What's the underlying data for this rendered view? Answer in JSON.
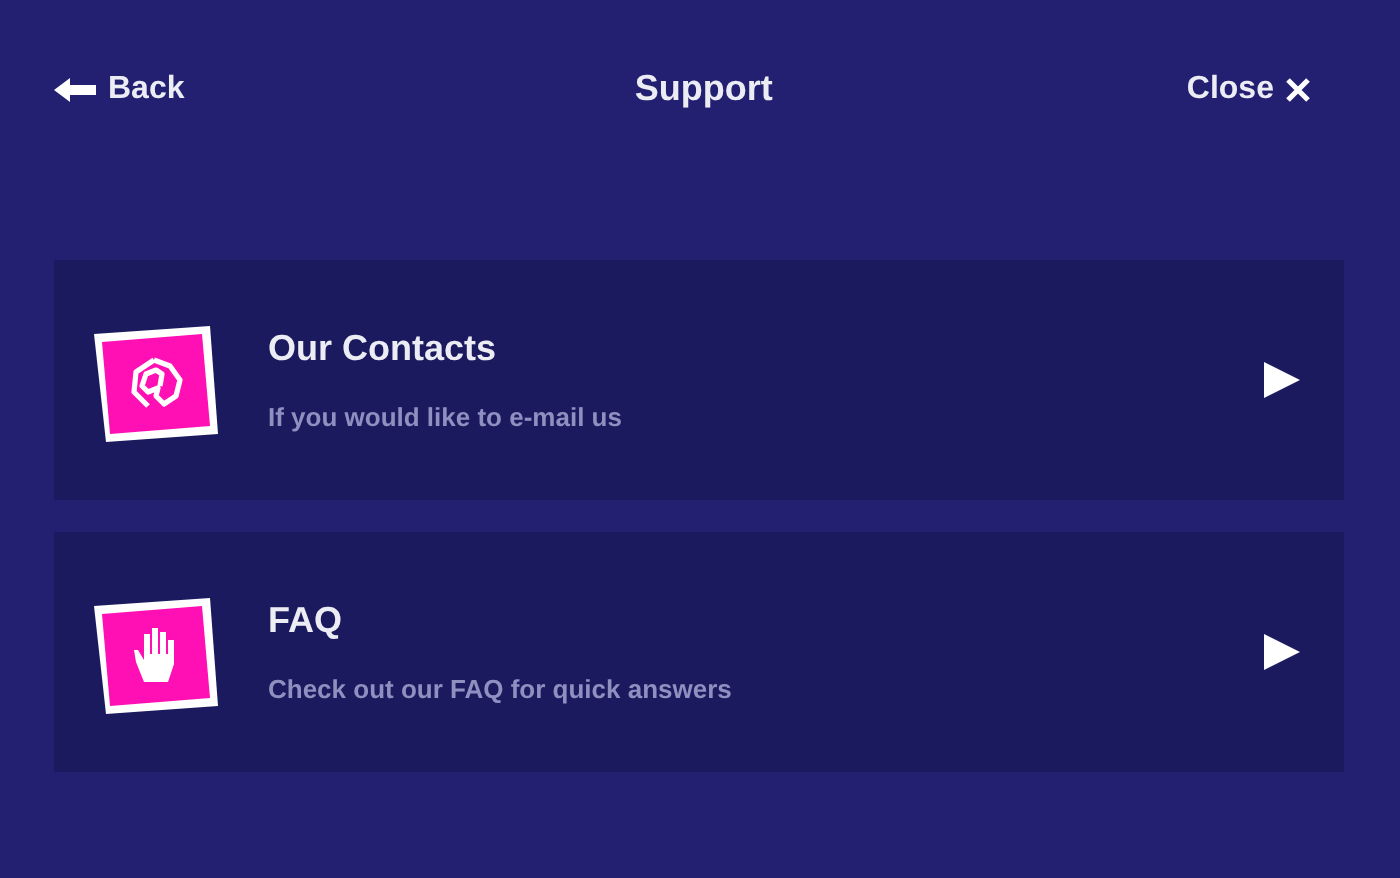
{
  "header": {
    "back": "Back",
    "title": "Support",
    "close": "Close"
  },
  "items": [
    {
      "kind": "email",
      "title": "Our Contacts",
      "subtitle": "If you would like to e-mail us"
    },
    {
      "kind": "hand",
      "title": "FAQ",
      "subtitle": "Check out our FAQ for quick answers"
    }
  ]
}
